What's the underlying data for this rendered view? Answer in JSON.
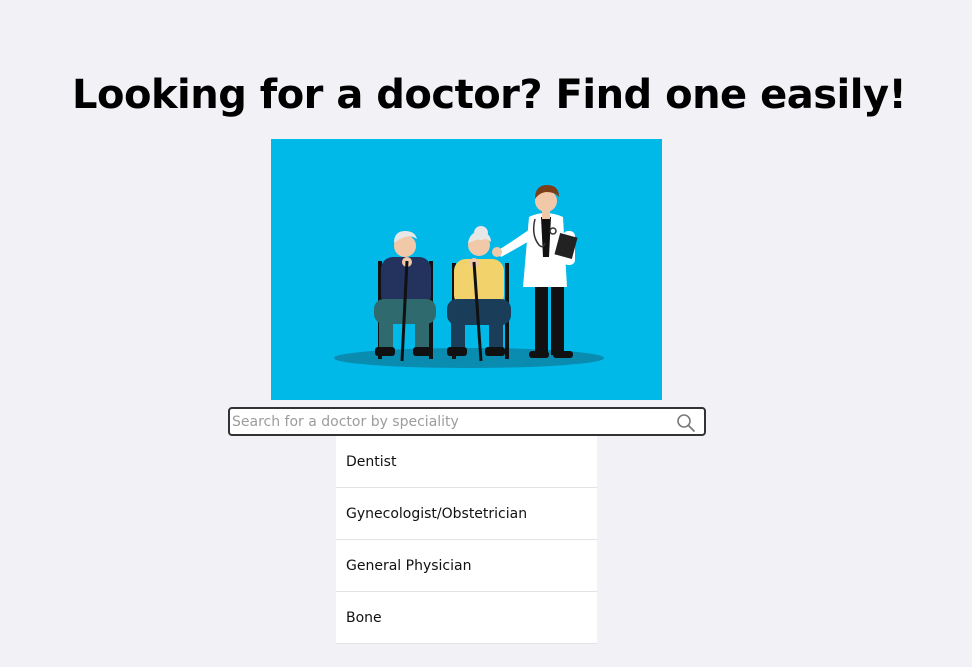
{
  "heading": "Looking for a doctor? Find one easily!",
  "search": {
    "placeholder": "Search for a doctor by speciality",
    "value": ""
  },
  "icons": {
    "search": "search-icon"
  },
  "suggestions": [
    "Dentist",
    "Gynecologist/Obstetrician",
    "General Physician",
    "Bone"
  ],
  "colors": {
    "page_background": "#f2f2f6",
    "hero_background": "#00b9e8",
    "heading_text": "#000000",
    "search_border": "#333333"
  }
}
